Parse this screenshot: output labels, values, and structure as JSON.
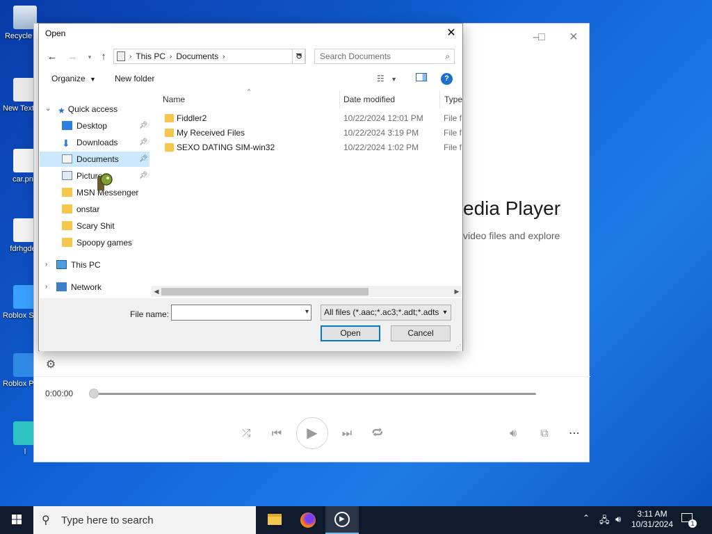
{
  "desktop": {
    "icons": [
      {
        "label": "Recycle Bin"
      },
      {
        "label": "New Text Document"
      },
      {
        "label": "car.png"
      },
      {
        "label": "fdrhgden"
      },
      {
        "label": "Roblox Studio"
      },
      {
        "label": "Roblox Player"
      },
      {
        "label": "l"
      }
    ]
  },
  "player": {
    "title_fragment": "edia Player",
    "subtitle_fragment": "video files and explore",
    "time": "0:00:00",
    "progress": 0,
    "controls": [
      "shuffle-icon",
      "previous-icon",
      "play-icon",
      "next-icon",
      "repeat-icon",
      "volume-icon",
      "miniplayer-icon",
      "more-icon"
    ]
  },
  "dialog": {
    "title": "Open",
    "address": {
      "crumbs": [
        "This PC",
        "Documents"
      ]
    },
    "search_placeholder": "Search Documents",
    "toolbar": {
      "organize": "Organize",
      "new_folder": "New folder"
    },
    "nav": {
      "quick_access": "Quick access",
      "items": [
        {
          "label": "Desktop"
        },
        {
          "label": "Downloads"
        },
        {
          "label": "Documents"
        },
        {
          "label": "Pictures"
        },
        {
          "label": "MSN Messenger"
        },
        {
          "label": "onstar"
        },
        {
          "label": "Scary Shit"
        },
        {
          "label": "Spoopy games"
        }
      ],
      "this_pc": "This PC",
      "network": "Network"
    },
    "columns": {
      "name": "Name",
      "date": "Date modified",
      "type": "Type"
    },
    "files": [
      {
        "name": "Fiddler2",
        "date": "10/22/2024 12:01 PM",
        "type": "File fo"
      },
      {
        "name": "My Received Files",
        "date": "10/22/2024 3:19 PM",
        "type": "File fo"
      },
      {
        "name": "SEXO DATING SIM-win32",
        "date": "10/22/2024 1:02 PM",
        "type": "File fo"
      }
    ],
    "filename_label": "File name:",
    "filename_value": "",
    "filter": "All files (*.aac;*.ac3;*.adt;*.adts;",
    "open_label": "Open",
    "cancel_label": "Cancel"
  },
  "taskbar": {
    "search_placeholder": "Type here to search",
    "time": "3:11 AM",
    "date": "10/31/2024",
    "notification_count": "1"
  }
}
